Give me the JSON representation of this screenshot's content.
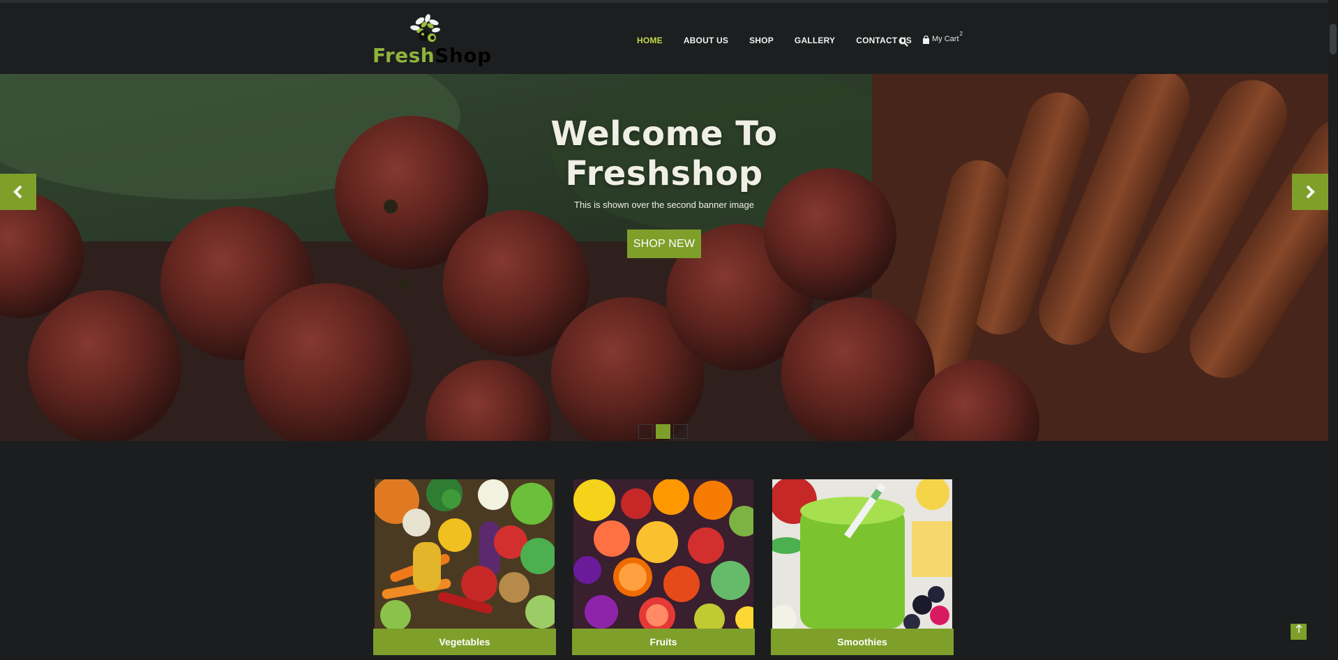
{
  "brand": {
    "name_part1": "Fresh",
    "name_part2": "Shop"
  },
  "nav": {
    "items": [
      {
        "label": "HOME",
        "active": true
      },
      {
        "label": "ABOUT US",
        "active": false
      },
      {
        "label": "SHOP",
        "active": false
      },
      {
        "label": "GALLERY",
        "active": false
      },
      {
        "label": "CONTACT US",
        "active": false
      }
    ],
    "search_icon": "search-icon",
    "cart_label": "My Cart",
    "cart_count": "2"
  },
  "hero": {
    "title_line1": "Welcome To",
    "title_line2": "Freshshop",
    "subtitle": "This is shown over the second banner image",
    "button_label": "SHOP NEW",
    "prev_icon": "chevron-left-icon",
    "next_icon": "chevron-right-icon",
    "slides": 3,
    "active_slide": 2
  },
  "categories": [
    {
      "label": "Vegetables"
    },
    {
      "label": "Fruits"
    },
    {
      "label": "Smoothies"
    }
  ],
  "back_to_top_icon": "arrow-up-icon",
  "colors": {
    "accent": "#7ea02a",
    "active_nav": "#c4d94b",
    "background": "#1b1d1e"
  }
}
